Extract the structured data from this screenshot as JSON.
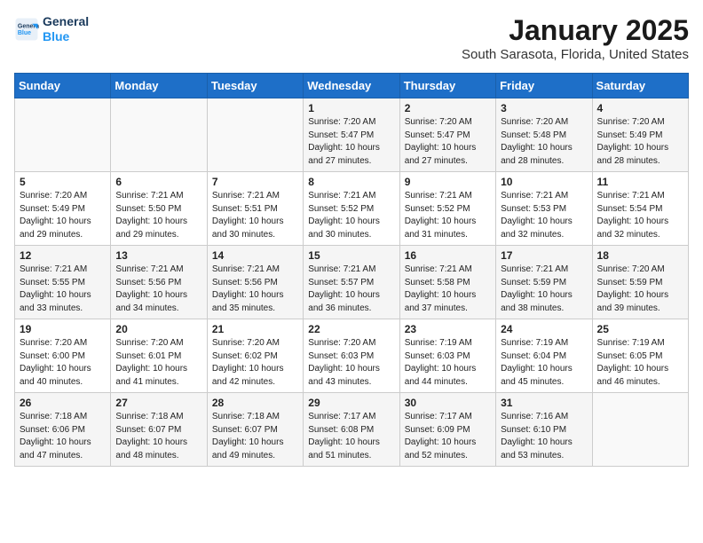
{
  "header": {
    "logo_line1": "General",
    "logo_line2": "Blue",
    "calendar_title": "January 2025",
    "calendar_subtitle": "South Sarasota, Florida, United States"
  },
  "days_of_week": [
    "Sunday",
    "Monday",
    "Tuesday",
    "Wednesday",
    "Thursday",
    "Friday",
    "Saturday"
  ],
  "weeks": [
    [
      {
        "day": "",
        "info": ""
      },
      {
        "day": "",
        "info": ""
      },
      {
        "day": "",
        "info": ""
      },
      {
        "day": "1",
        "info": "Sunrise: 7:20 AM\nSunset: 5:47 PM\nDaylight: 10 hours\nand 27 minutes."
      },
      {
        "day": "2",
        "info": "Sunrise: 7:20 AM\nSunset: 5:47 PM\nDaylight: 10 hours\nand 27 minutes."
      },
      {
        "day": "3",
        "info": "Sunrise: 7:20 AM\nSunset: 5:48 PM\nDaylight: 10 hours\nand 28 minutes."
      },
      {
        "day": "4",
        "info": "Sunrise: 7:20 AM\nSunset: 5:49 PM\nDaylight: 10 hours\nand 28 minutes."
      }
    ],
    [
      {
        "day": "5",
        "info": "Sunrise: 7:20 AM\nSunset: 5:49 PM\nDaylight: 10 hours\nand 29 minutes."
      },
      {
        "day": "6",
        "info": "Sunrise: 7:21 AM\nSunset: 5:50 PM\nDaylight: 10 hours\nand 29 minutes."
      },
      {
        "day": "7",
        "info": "Sunrise: 7:21 AM\nSunset: 5:51 PM\nDaylight: 10 hours\nand 30 minutes."
      },
      {
        "day": "8",
        "info": "Sunrise: 7:21 AM\nSunset: 5:52 PM\nDaylight: 10 hours\nand 30 minutes."
      },
      {
        "day": "9",
        "info": "Sunrise: 7:21 AM\nSunset: 5:52 PM\nDaylight: 10 hours\nand 31 minutes."
      },
      {
        "day": "10",
        "info": "Sunrise: 7:21 AM\nSunset: 5:53 PM\nDaylight: 10 hours\nand 32 minutes."
      },
      {
        "day": "11",
        "info": "Sunrise: 7:21 AM\nSunset: 5:54 PM\nDaylight: 10 hours\nand 32 minutes."
      }
    ],
    [
      {
        "day": "12",
        "info": "Sunrise: 7:21 AM\nSunset: 5:55 PM\nDaylight: 10 hours\nand 33 minutes."
      },
      {
        "day": "13",
        "info": "Sunrise: 7:21 AM\nSunset: 5:56 PM\nDaylight: 10 hours\nand 34 minutes."
      },
      {
        "day": "14",
        "info": "Sunrise: 7:21 AM\nSunset: 5:56 PM\nDaylight: 10 hours\nand 35 minutes."
      },
      {
        "day": "15",
        "info": "Sunrise: 7:21 AM\nSunset: 5:57 PM\nDaylight: 10 hours\nand 36 minutes."
      },
      {
        "day": "16",
        "info": "Sunrise: 7:21 AM\nSunset: 5:58 PM\nDaylight: 10 hours\nand 37 minutes."
      },
      {
        "day": "17",
        "info": "Sunrise: 7:21 AM\nSunset: 5:59 PM\nDaylight: 10 hours\nand 38 minutes."
      },
      {
        "day": "18",
        "info": "Sunrise: 7:20 AM\nSunset: 5:59 PM\nDaylight: 10 hours\nand 39 minutes."
      }
    ],
    [
      {
        "day": "19",
        "info": "Sunrise: 7:20 AM\nSunset: 6:00 PM\nDaylight: 10 hours\nand 40 minutes."
      },
      {
        "day": "20",
        "info": "Sunrise: 7:20 AM\nSunset: 6:01 PM\nDaylight: 10 hours\nand 41 minutes."
      },
      {
        "day": "21",
        "info": "Sunrise: 7:20 AM\nSunset: 6:02 PM\nDaylight: 10 hours\nand 42 minutes."
      },
      {
        "day": "22",
        "info": "Sunrise: 7:20 AM\nSunset: 6:03 PM\nDaylight: 10 hours\nand 43 minutes."
      },
      {
        "day": "23",
        "info": "Sunrise: 7:19 AM\nSunset: 6:03 PM\nDaylight: 10 hours\nand 44 minutes."
      },
      {
        "day": "24",
        "info": "Sunrise: 7:19 AM\nSunset: 6:04 PM\nDaylight: 10 hours\nand 45 minutes."
      },
      {
        "day": "25",
        "info": "Sunrise: 7:19 AM\nSunset: 6:05 PM\nDaylight: 10 hours\nand 46 minutes."
      }
    ],
    [
      {
        "day": "26",
        "info": "Sunrise: 7:18 AM\nSunset: 6:06 PM\nDaylight: 10 hours\nand 47 minutes."
      },
      {
        "day": "27",
        "info": "Sunrise: 7:18 AM\nSunset: 6:07 PM\nDaylight: 10 hours\nand 48 minutes."
      },
      {
        "day": "28",
        "info": "Sunrise: 7:18 AM\nSunset: 6:07 PM\nDaylight: 10 hours\nand 49 minutes."
      },
      {
        "day": "29",
        "info": "Sunrise: 7:17 AM\nSunset: 6:08 PM\nDaylight: 10 hours\nand 51 minutes."
      },
      {
        "day": "30",
        "info": "Sunrise: 7:17 AM\nSunset: 6:09 PM\nDaylight: 10 hours\nand 52 minutes."
      },
      {
        "day": "31",
        "info": "Sunrise: 7:16 AM\nSunset: 6:10 PM\nDaylight: 10 hours\nand 53 minutes."
      },
      {
        "day": "",
        "info": ""
      }
    ]
  ]
}
